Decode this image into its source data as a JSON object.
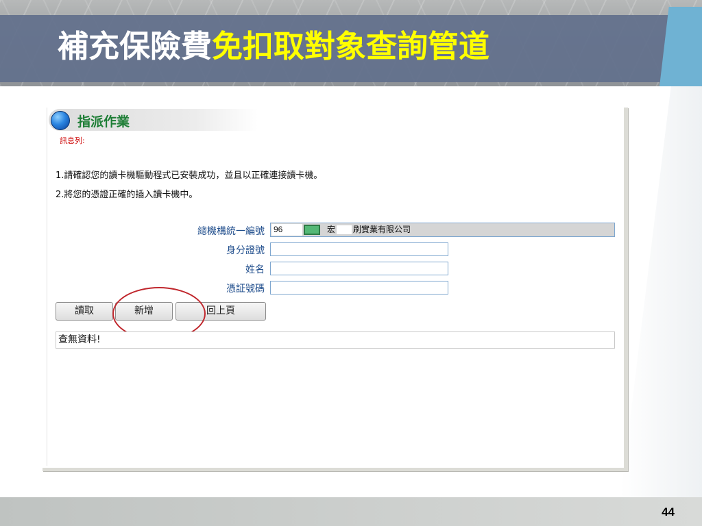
{
  "slide": {
    "title_white": "補充保險費",
    "title_yellow": "免扣取對象查詢管道",
    "page_number": "44"
  },
  "form": {
    "section_heading": "指派作業",
    "message_label": "訊息列:",
    "instructions": [
      "1.請確認您的讀卡機驅動程式已安裝成功，並且以正確連接讀卡機。",
      "2.將您的憑證正確的插入讀卡機中。"
    ],
    "fields": {
      "org_label": "總機構統一編號",
      "org_code": "96",
      "org_name_prefix": "宏",
      "org_name_suffix": "刷實業有限公司",
      "id_label": "身分證號",
      "id_value": "",
      "name_label": "姓名",
      "name_value": "",
      "cert_label": "憑証號碼",
      "cert_value": ""
    },
    "buttons": {
      "read": "讀取",
      "add": "新增",
      "back": "回上頁"
    },
    "result_text": "查無資料!"
  },
  "colors": {
    "title_yellow": "#ffff00",
    "annotation_circle": "#c0272d",
    "heading_green": "#1e7e36",
    "label_blue": "#1f4d8c"
  }
}
